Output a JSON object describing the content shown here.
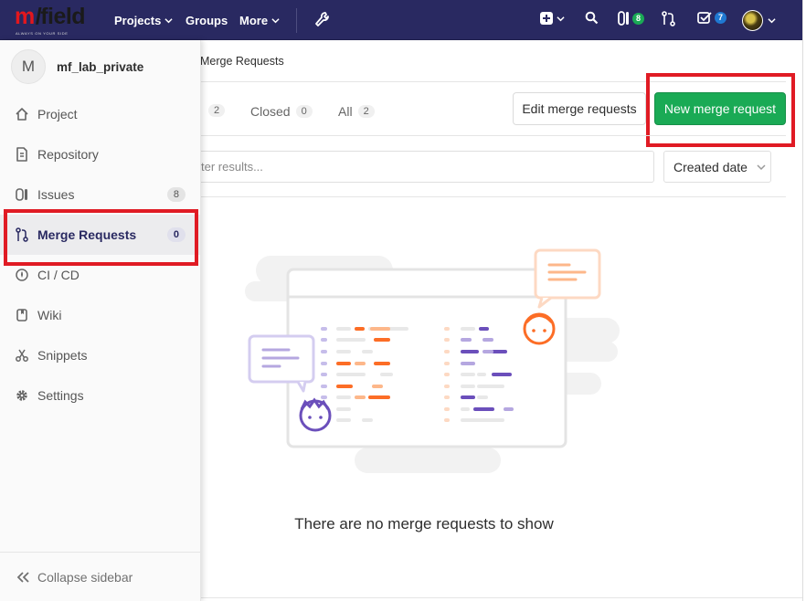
{
  "brand": {
    "logo_m": "m",
    "logo_field": "field",
    "tagline": "ALWAYS ON YOUR SIDE"
  },
  "navbar": {
    "projects_label": "Projects",
    "groups_label": "Groups",
    "more_label": "More",
    "issues_count": "8",
    "todos_count": "7",
    "colors": {
      "bg": "#292961",
      "issues_badge": "#1aaa55",
      "todos_badge": "#1f78d1"
    }
  },
  "sidebar": {
    "project_initial": "M",
    "project_name": "mf_lab_private",
    "items": [
      {
        "label": "Project",
        "icon": "home-icon"
      },
      {
        "label": "Repository",
        "icon": "document-icon"
      },
      {
        "label": "Issues",
        "icon": "issues-icon",
        "count": "8"
      },
      {
        "label": "Merge Requests",
        "icon": "git-merge-icon",
        "count": "0",
        "active": true
      },
      {
        "label": "CI / CD",
        "icon": "rocket-icon"
      },
      {
        "label": "Wiki",
        "icon": "book-icon"
      },
      {
        "label": "Snippets",
        "icon": "scissors-icon"
      },
      {
        "label": "Settings",
        "icon": "gear-icon"
      }
    ],
    "collapse_label": "Collapse sidebar"
  },
  "main": {
    "breadcrumb": "Merge Requests",
    "tabs": [
      {
        "label": "",
        "count": "2"
      },
      {
        "label": "Closed",
        "count": "0"
      },
      {
        "label": "All",
        "count": "2"
      }
    ],
    "edit_button": "Edit merge requests",
    "new_button": "New merge request",
    "filter_placeholder": "ter results...",
    "sort_label": "Created date",
    "empty_state": "There are no merge requests to show"
  },
  "colors": {
    "accent_green": "#1aaa55",
    "highlight_red": "#e01b24",
    "illus_orange": "#fc6d26",
    "illus_purple": "#6b4fbb"
  }
}
